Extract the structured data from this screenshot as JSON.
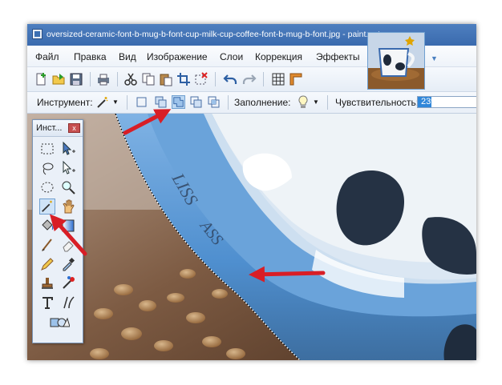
{
  "window": {
    "title": "oversized-ceramic-font-b-mug-b-font-cup-milk-cup-coffee-font-b-mug-b-font.jpg - paint.net вер..."
  },
  "menu": {
    "items": [
      "Файл",
      "Правка",
      "Вид",
      "Изображение",
      "Слои",
      "Коррекция",
      "Эффекты"
    ]
  },
  "toolbar": {
    "icons": [
      "new-icon",
      "open-icon",
      "save-icon",
      "print-icon",
      "cut-icon",
      "copy-icon",
      "paste-icon",
      "crop-icon",
      "deselect-icon",
      "undo-icon",
      "redo-icon",
      "grid-icon",
      "ruler-icon"
    ]
  },
  "options": {
    "tool_label": "Инструмент:",
    "fill_label": "Заполнение:",
    "sensitivity_label": "Чувствительность:",
    "sensitivity_value": "23%",
    "sensitivity_fraction": 0.23,
    "active_mode": "union"
  },
  "tools_window": {
    "title": "Инст...",
    "close": "x",
    "tools": [
      "rectangle-select",
      "move-selection",
      "lasso-select",
      "move-selected",
      "ellipse-select",
      "zoom",
      "magic-wand",
      "pan",
      "paint-bucket",
      "gradient",
      "paintbrush",
      "eraser",
      "pencil",
      "color-picker",
      "clone-stamp",
      "recolor",
      "text",
      "line-curve",
      "shapes"
    ],
    "active_tool": "magic-wand"
  },
  "colors": {
    "accent": "#2f86d9",
    "arrow": "#d81e26",
    "titlebar": "#3a6aae"
  }
}
